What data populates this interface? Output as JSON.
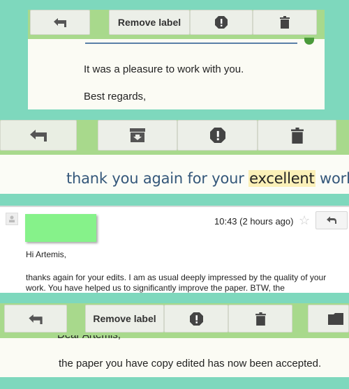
{
  "panel1": {
    "toolbar": {
      "remove_label": "Remove label"
    },
    "email": {
      "line1": "It was a pleasure to work with you.",
      "line2": "Best regards,"
    }
  },
  "panel2": {
    "sentence": {
      "before": "thank you again for your ",
      "highlight": "excellent",
      "after": " work."
    }
  },
  "panel3": {
    "time": "10:43 (2 hours ago)",
    "greeting": "Hi Artemis,",
    "body": "thanks again for your edits. I am as usual deeply impressed by the quality of your work. You have helped us to significantly improve the paper. BTW, the"
  },
  "panel4": {
    "toolbar": {
      "remove_label": "Remove label"
    },
    "email": {
      "partial_greeting": "Dear Artemis,",
      "line1": "the paper you have copy edited has now been accepted."
    }
  },
  "colors": {
    "background": "#7ed8bd",
    "toolbar": "#a8d98c",
    "button": "#ecefe8",
    "highlight": "#fbf0b8",
    "redacted": "#86f28a"
  }
}
